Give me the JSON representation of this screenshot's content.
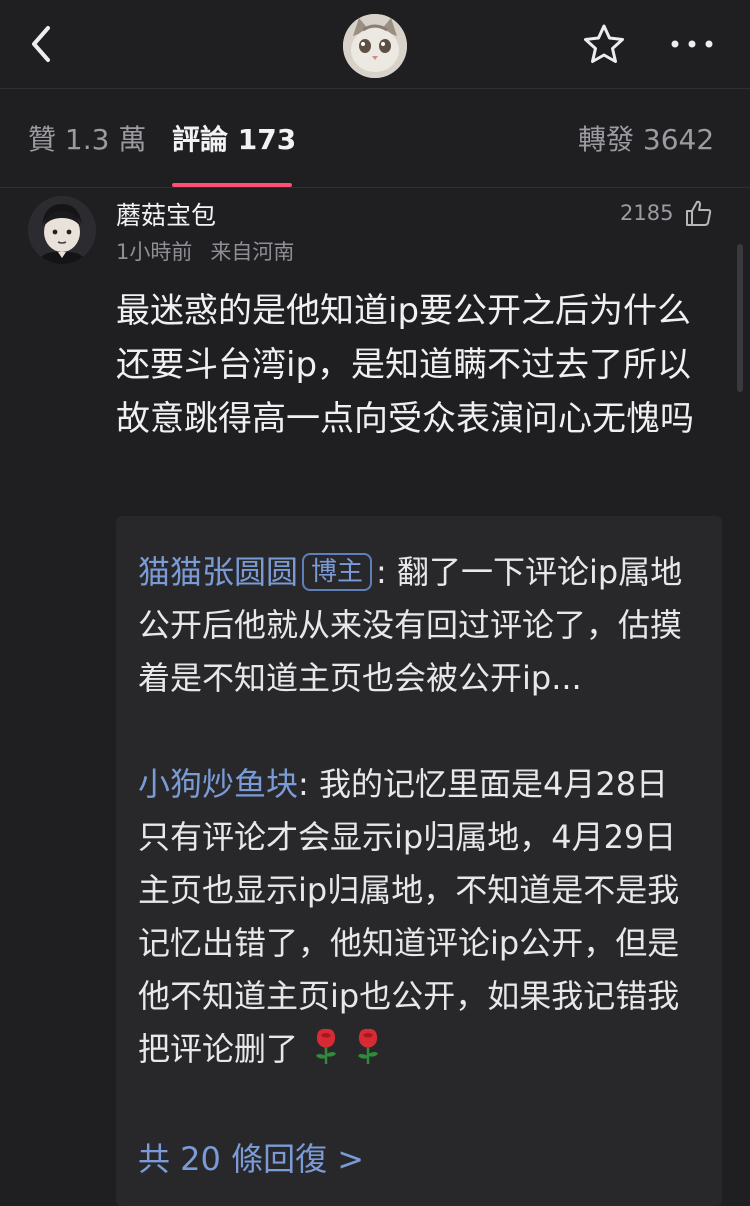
{
  "tabs": {
    "likes": "贊 1.3 萬",
    "comments": "評論 173",
    "reposts": "轉發 3642"
  },
  "comment": {
    "username": "蘑菇宝包",
    "time": "1小時前",
    "location": "来自河南",
    "like_count": "2185",
    "text": "最迷惑的是他知道ip要公开之后为什么还要斗台湾ip，是知道瞒不过去了所以故意跳得高一点向受众表演问心无愧吗"
  },
  "replies": [
    {
      "name": "猫猫张圆圆",
      "badge": "博主",
      "text": ": 翻了一下评论ip属地公开后他就从来没有回过评论了，估摸着是不知道主页也会被公开ip..."
    },
    {
      "name": "小狗炒鱼块",
      "text": ": 我的记忆里面是4月28日只有评论才会显示ip归属地，4月29日主页也显示ip归属地，不知道是不是我记忆出错了，他知道评论ip公开，但是他不知道主页ip也公开，如果我记错我把评论删了"
    }
  ],
  "more_replies": "共 20 條回復 >",
  "icons": {
    "back": "back-arrow-icon",
    "star": "star-outline-icon",
    "more": "more-dots-icon",
    "like": "thumbs-up-icon",
    "rose": "rose-emoji-icon"
  },
  "colors": {
    "background": "#1f1f21",
    "accent_underline": "#ff4f72",
    "link_blue": "#7a9bd6"
  }
}
